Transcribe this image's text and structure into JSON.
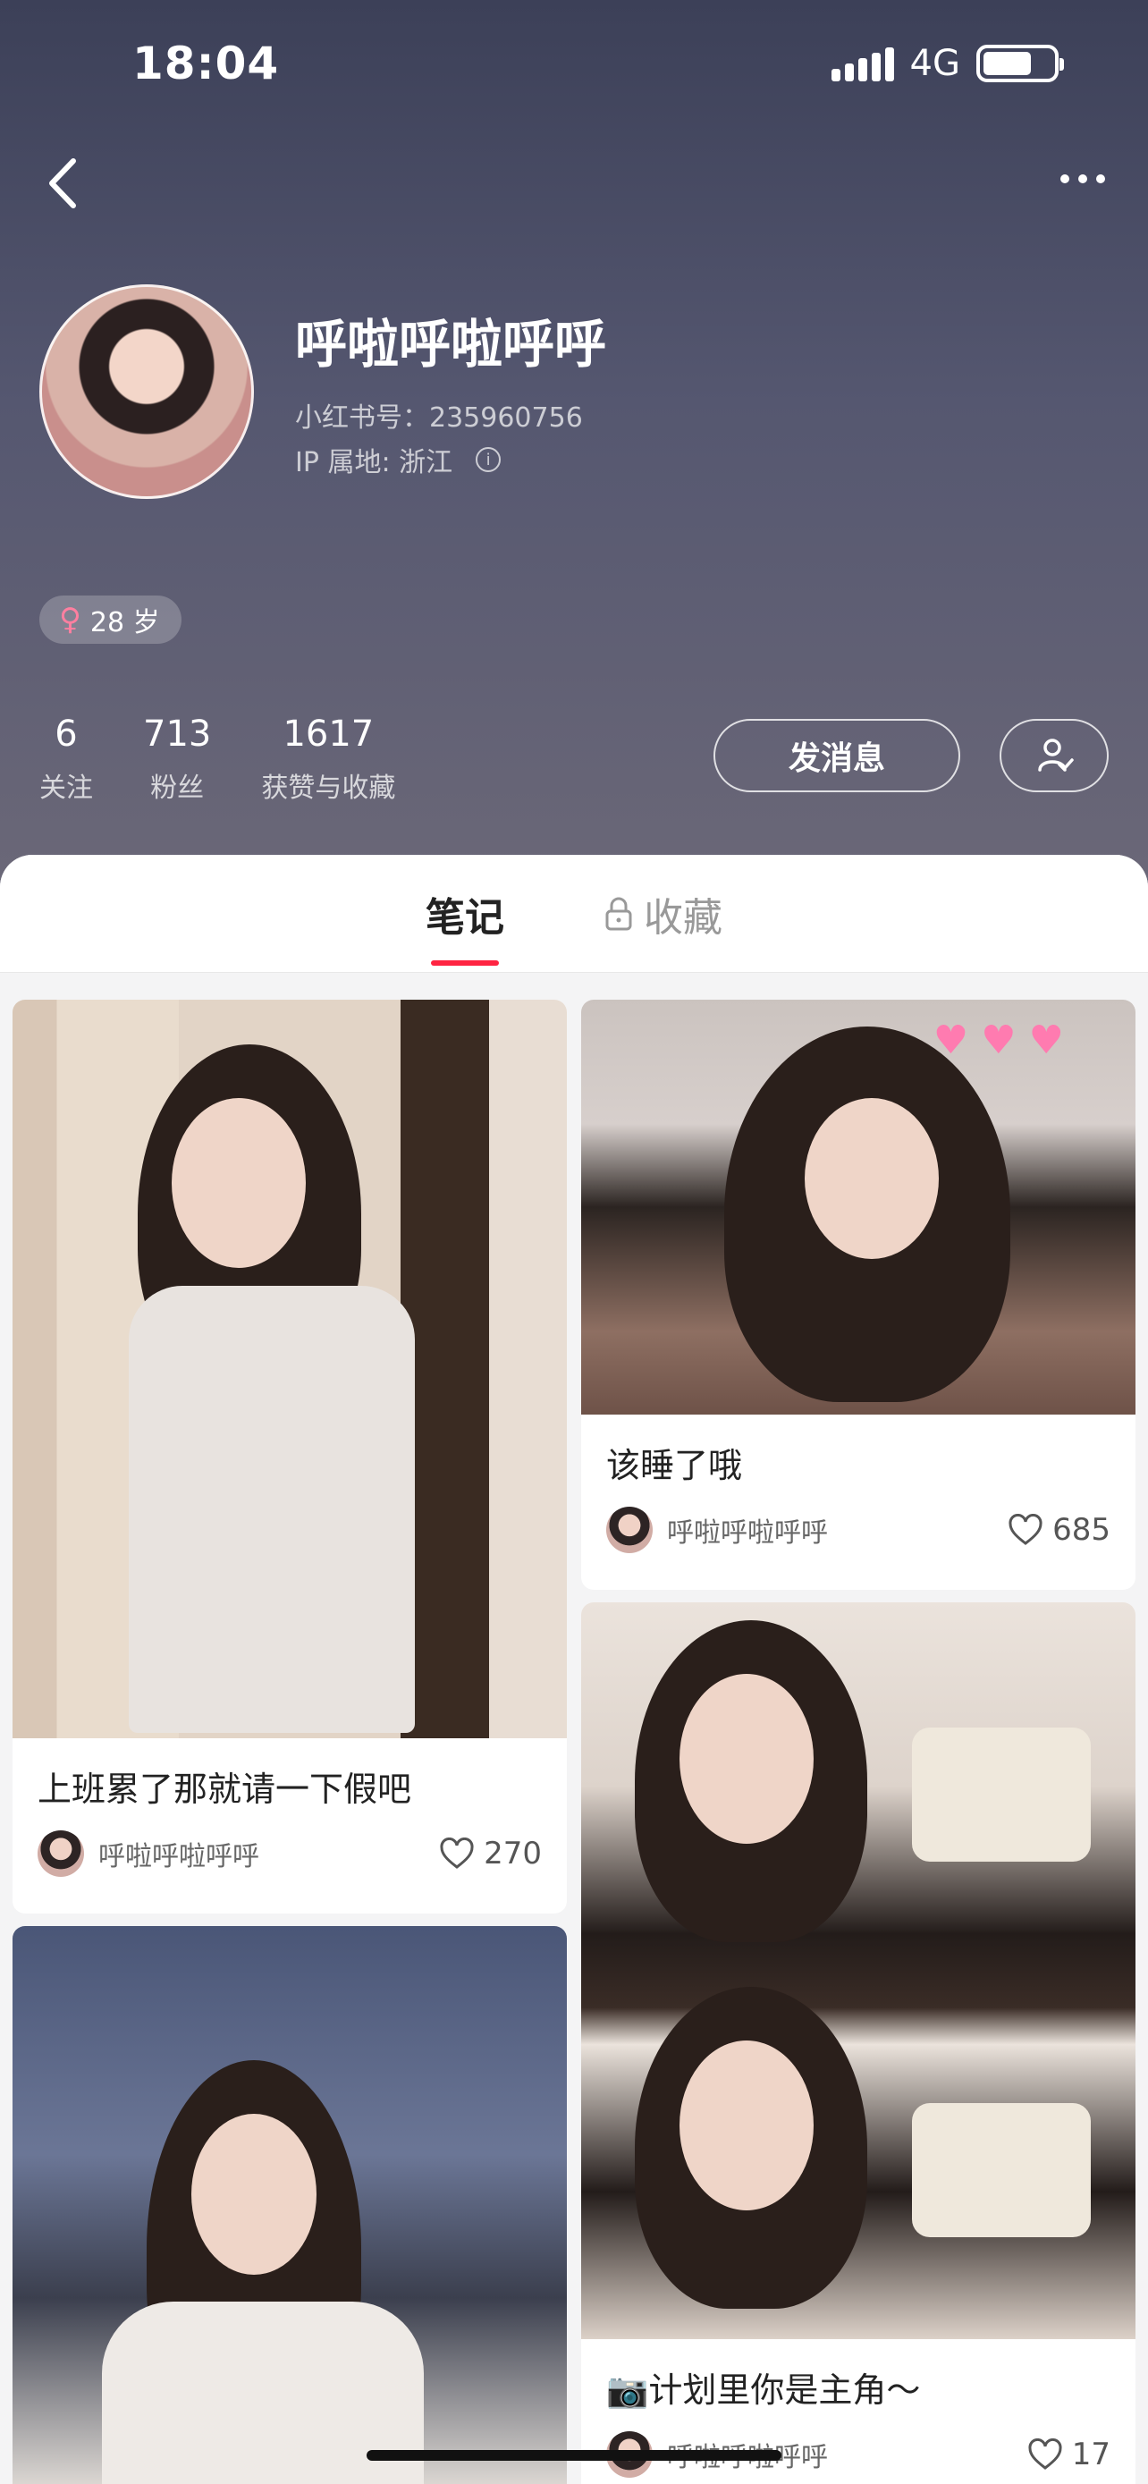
{
  "status_bar": {
    "time": "18:04",
    "network": "4G"
  },
  "profile": {
    "nickname": "呼啦呼啦呼呼",
    "red_id": "小红书号：235960756",
    "ip_location": "IP 属地: 浙江",
    "gender_age": "28 岁"
  },
  "stats": [
    {
      "value": "6",
      "label": "关注"
    },
    {
      "value": "713",
      "label": "粉丝"
    },
    {
      "value": "1617",
      "label": "获赞与收藏"
    }
  ],
  "actions": {
    "message_label": "发消息"
  },
  "tabs": [
    {
      "label": "笔记",
      "active": true
    },
    {
      "label": "收藏",
      "locked": true
    }
  ],
  "notes": [
    {
      "title": "上班累了那就请一下假吧",
      "author": "呼啦呼啦呼呼",
      "likes": "270"
    },
    {
      "title": "该睡了哦",
      "author": "呼啦呼啦呼呼",
      "likes": "685"
    },
    {
      "title": "📷计划里你是主角～",
      "author": "呼啦呼啦呼呼",
      "likes": "17"
    }
  ],
  "colors": {
    "accent": "#ff2442",
    "header_top": "#3c4058",
    "header_bottom": "#6b6878"
  },
  "icons": [
    "back-arrow-icon",
    "more-dots-icon",
    "female-icon",
    "info-icon",
    "follow-user-icon",
    "lock-icon",
    "heart-icon"
  ]
}
